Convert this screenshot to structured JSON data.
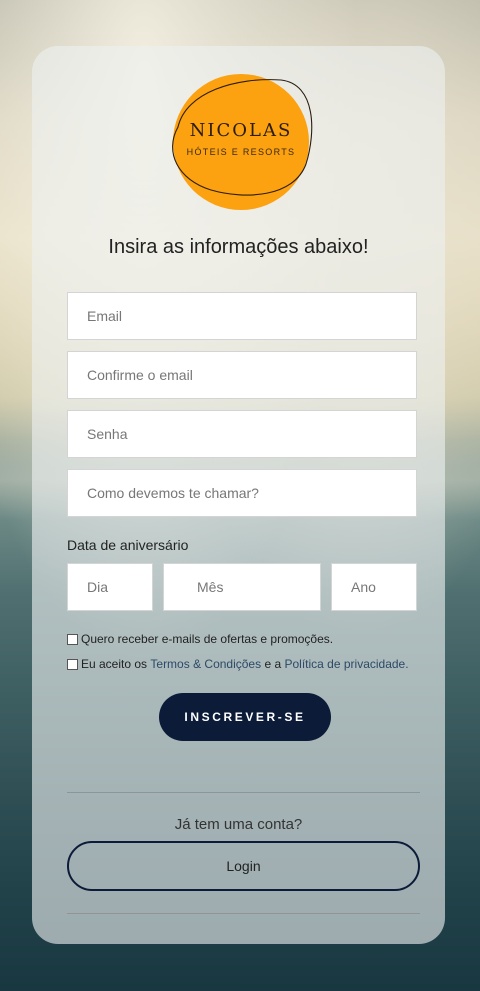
{
  "logo": {
    "name": "NICOLAS",
    "tagline": "HÓTEIS E RESORTS",
    "color": "#fca10f"
  },
  "form": {
    "heading": "Insira as informações abaixo!",
    "email_placeholder": "Email",
    "confirm_email_placeholder": "Confirme o email",
    "password_placeholder": "Senha",
    "nickname_placeholder": "Como devemos te chamar?",
    "birthday_label": "Data de aniversário",
    "day_placeholder": "Dia",
    "month_placeholder": "Mês",
    "year_placeholder": "Ano",
    "offers_consent": "Quero receber e-mails de ofertas e promoções.",
    "terms_prefix": "Eu aceito os",
    "terms_link": "Termos & Condições",
    "terms_and": "e a",
    "privacy_link": "Política de privacidade.",
    "submit_label": "INSCREVER-SE"
  },
  "login": {
    "prompt": "Já tem uma conta?",
    "button_label": "Login"
  },
  "colors": {
    "primary_button": "#0c1b38",
    "link": "#2d4a66"
  }
}
